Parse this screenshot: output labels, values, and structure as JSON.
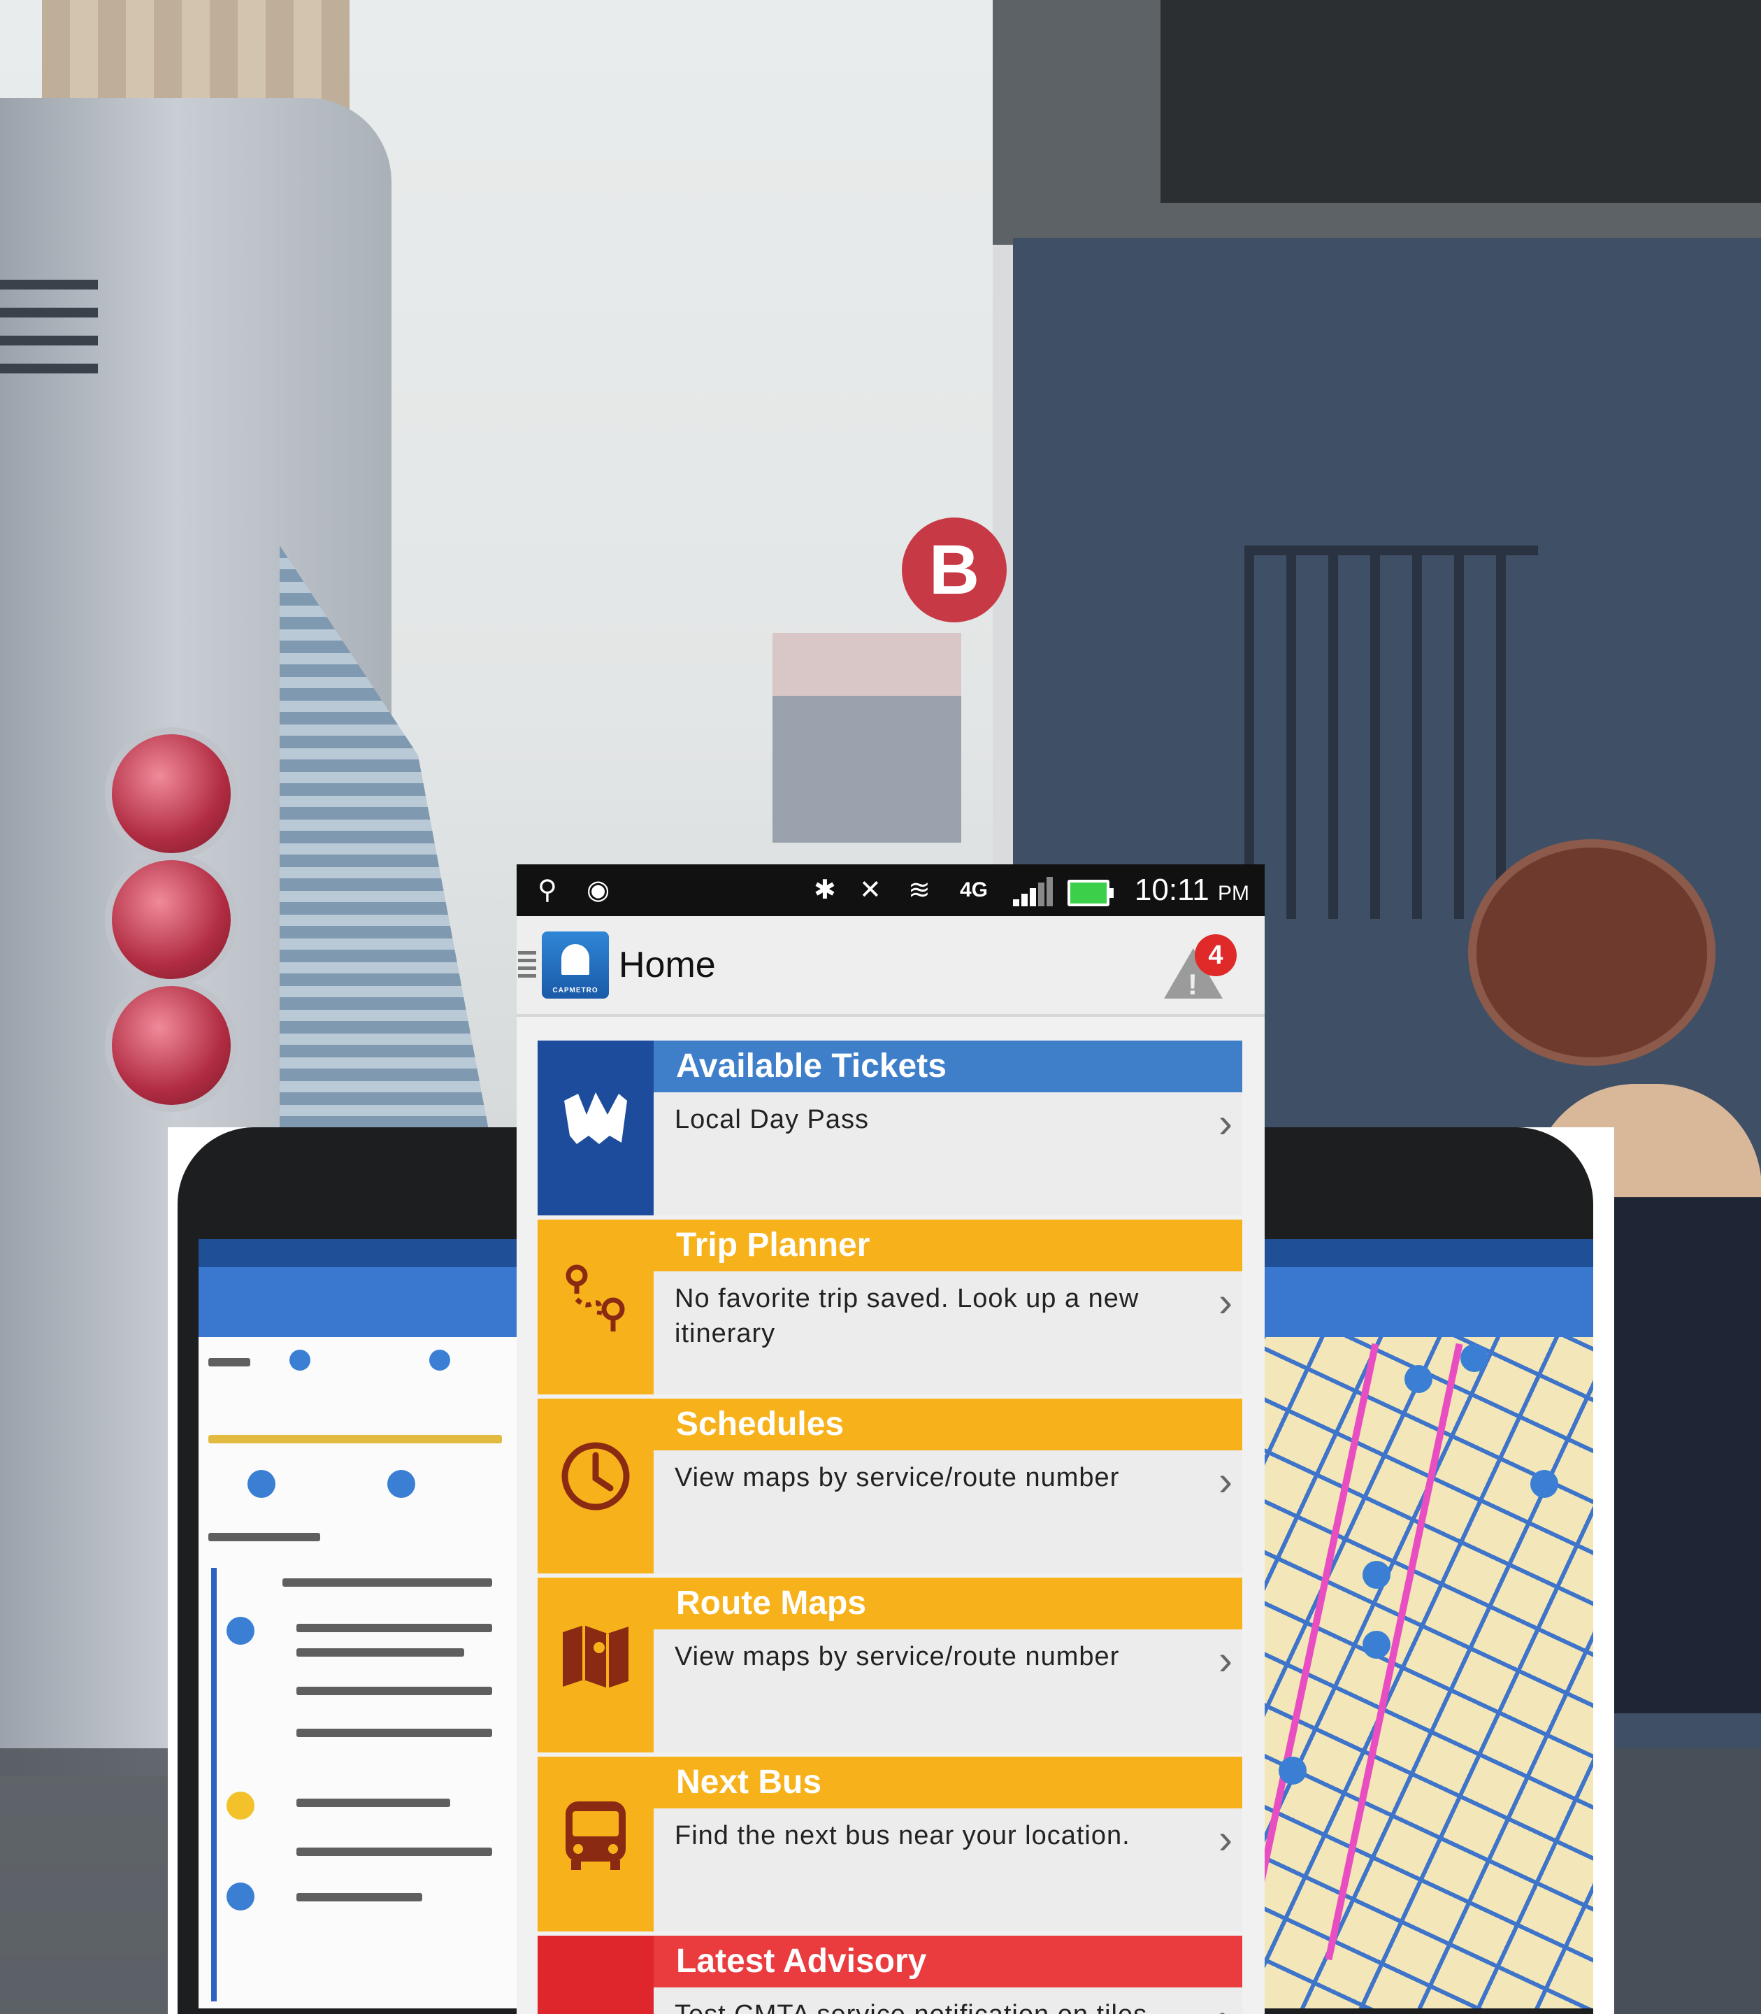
{
  "status_bar": {
    "time": "10:11",
    "ampm": "PM",
    "network": "4G"
  },
  "app_bar": {
    "title": "Home",
    "alert_count": "4",
    "logo_text": "CAPMETRO"
  },
  "tiles": [
    {
      "title": "Available Tickets",
      "body": "Local Day Pass",
      "color": "#3f7fc9",
      "icon": "ticket-icon"
    },
    {
      "title": "Trip Planner",
      "body": "No favorite trip saved. Look up a new itinerary",
      "color": "#f7b21b",
      "icon": "route-pin-icon"
    },
    {
      "title": "Schedules",
      "body": "View maps by service/route number",
      "color": "#f7b21b",
      "icon": "clock-icon"
    },
    {
      "title": "Route Maps",
      "body": "View maps by service/route number",
      "color": "#f7b21b",
      "icon": "map-icon"
    },
    {
      "title": "Next Bus",
      "body": "Find the next bus near your location.",
      "color": "#f7b21b",
      "icon": "bus-icon"
    },
    {
      "title": "Latest Advisory",
      "body": "Test CMTA service notification on tiles",
      "color": "#ea3b3f",
      "icon": "warning-icon"
    }
  ],
  "background_signs": {
    "bus_stop_letter": "B"
  },
  "colors": {
    "brand_blue": "#1d4c9c",
    "accent_yellow": "#f7b21b",
    "alert_red": "#e0262d"
  }
}
